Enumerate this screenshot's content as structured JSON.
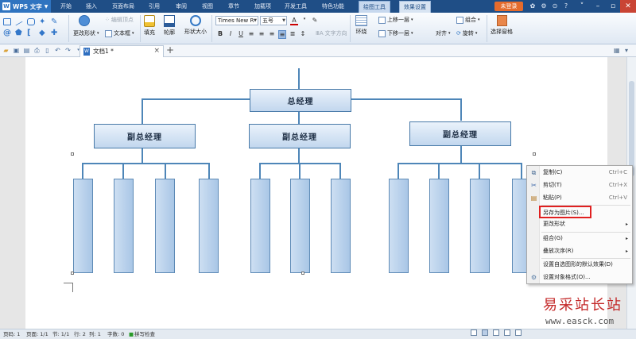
{
  "app": {
    "name": "WPS 文字"
  },
  "menu": [
    "开始",
    "插入",
    "页面布局",
    "引用",
    "审阅",
    "视图",
    "章节",
    "加载项",
    "开发工具",
    "特色功能"
  ],
  "context_tabs": {
    "drawing": "绘图工具",
    "effects": "效果设置"
  },
  "login_label": "未登录",
  "ribbon": {
    "change_shape": "更改形状",
    "text_box": "文本框",
    "edit_vertices": "编辑顶点",
    "fill": "填充",
    "outline": "轮廓",
    "shape_size": "形状大小",
    "font_name": "Times New R",
    "font_size": "五号",
    "text_direction": "文字方向",
    "wrap": "环绕",
    "bring_forward": "上移一层",
    "send_backward": "下移一层",
    "align": "对齐",
    "group": "组合",
    "rotate": "旋转",
    "select_pane": "选择窗格"
  },
  "doc_tab": {
    "name": "文档1 *"
  },
  "org_chart": {
    "top": "总经理",
    "deputies": [
      "副总经理",
      "副总经理",
      "副总经理"
    ]
  },
  "context_menu": {
    "items": [
      {
        "label": "复制(C)",
        "shortcut": "Ctrl+C",
        "icon": "copy-icon"
      },
      {
        "label": "剪切(T)",
        "shortcut": "Ctrl+X",
        "icon": "cut-icon"
      },
      {
        "label": "粘贴(P)",
        "shortcut": "Ctrl+V",
        "icon": "paste-icon"
      },
      {
        "label": "另存为图片(S)...",
        "shortcut": "",
        "icon": "",
        "highlighted": true
      },
      {
        "label": "更改形状",
        "submenu": true
      },
      {
        "label": "组合(G)",
        "submenu": true
      },
      {
        "label": "叠放次序(R)",
        "submenu": true
      },
      {
        "label": "设置自选图形的默认效果(D)"
      },
      {
        "label": "设置对象格式(O)...",
        "icon": "format-icon"
      }
    ]
  },
  "watermark": {
    "cn": "易采站长站",
    "url": "www.easck.com"
  },
  "statusbar": {
    "page": "页码: 1",
    "pages": "页面: 1/1",
    "section": "节: 1/1",
    "row": "行: 2",
    "col": "列: 1",
    "words": "字数: 0",
    "spell": "拼写检查"
  },
  "colors": {
    "title_bar": "#1f4e86",
    "accent": "#2f74c0",
    "box_fill": "#c2d7ee",
    "highlight_border": "#e02020",
    "login": "#e56b2c"
  }
}
